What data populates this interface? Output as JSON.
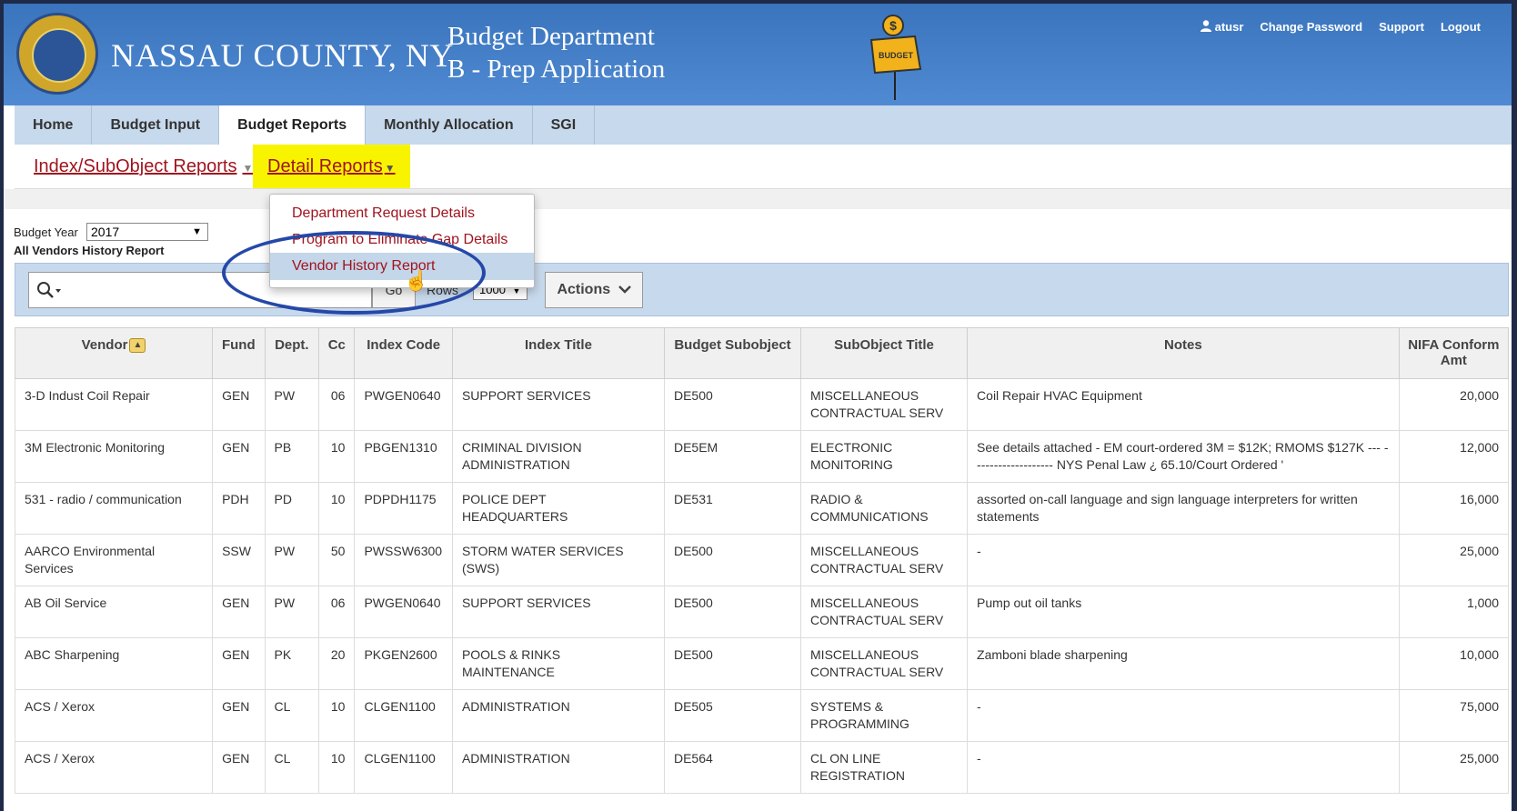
{
  "header": {
    "county": "NASSAU COUNTY, NY",
    "dept_line1": "Budget Department",
    "dept_line2": "B - Prep Application",
    "sign_text": "BUDGET",
    "user": "atusr",
    "change_password": "Change Password",
    "support": "Support",
    "logout": "Logout"
  },
  "tabs": [
    {
      "label": "Home"
    },
    {
      "label": "Budget Input"
    },
    {
      "label": "Budget Reports",
      "active": true
    },
    {
      "label": "Monthly Allocation"
    },
    {
      "label": "SGI"
    }
  ],
  "subnav": {
    "index_reports": "Index/SubObject Reports",
    "detail_reports": "Detail Reports"
  },
  "dropdown": [
    "Department Request Details",
    "Program to Eliminate Gap Details",
    "Vendor History Report"
  ],
  "filters": {
    "budget_year_label": "Budget Year",
    "budget_year_value": "2017",
    "report_title": "All Vendors History Report"
  },
  "toolbar": {
    "go_label": "Go",
    "rows_label": "Rows",
    "rows_value": "1000",
    "actions_label": "Actions"
  },
  "table": {
    "columns": [
      "Vendor",
      "Fund",
      "Dept.",
      "Cc",
      "Index Code",
      "Index Title",
      "Budget Subobject",
      "SubObject Title",
      "Notes",
      "NIFA Conform Amt"
    ],
    "rows": [
      [
        "3-D Indust Coil Repair",
        "GEN",
        "PW",
        "06",
        "PWGEN0640",
        "SUPPORT SERVICES",
        "DE500",
        "MISCELLANEOUS CONTRACTUAL SERV",
        "Coil Repair HVAC Equipment",
        "20,000"
      ],
      [
        "3M Electronic Monitoring",
        "GEN",
        "PB",
        "10",
        "PBGEN1310",
        "CRIMINAL DIVISION ADMINISTRATION",
        "DE5EM",
        "ELECTRONIC MONITORING",
        "See details attached - EM court-ordered 3M = $12K; RMOMS $127K --- ------------------- NYS Penal Law ¿ 65.10/Court Ordered '",
        "12,000"
      ],
      [
        "531 - radio / communication",
        "PDH",
        "PD",
        "10",
        "PDPDH1175",
        "POLICE DEPT HEADQUARTERS",
        "DE531",
        "RADIO & COMMUNICATIONS",
        "assorted on-call language and sign language interpreters for written statements",
        "16,000"
      ],
      [
        "AARCO Environmental Services",
        "SSW",
        "PW",
        "50",
        "PWSSW6300",
        "STORM WATER SERVICES (SWS)",
        "DE500",
        "MISCELLANEOUS CONTRACTUAL SERV",
        "-",
        "25,000"
      ],
      [
        "AB Oil Service",
        "GEN",
        "PW",
        "06",
        "PWGEN0640",
        "SUPPORT SERVICES",
        "DE500",
        "MISCELLANEOUS CONTRACTUAL SERV",
        "Pump out oil tanks",
        "1,000"
      ],
      [
        "ABC Sharpening",
        "GEN",
        "PK",
        "20",
        "PKGEN2600",
        "POOLS & RINKS MAINTENANCE",
        "DE500",
        "MISCELLANEOUS CONTRACTUAL SERV",
        "Zamboni blade sharpening",
        "10,000"
      ],
      [
        "ACS / Xerox",
        "GEN",
        "CL",
        "10",
        "CLGEN1100",
        "ADMINISTRATION",
        "DE505",
        "SYSTEMS & PROGRAMMING",
        "-",
        "75,000"
      ],
      [
        "ACS / Xerox",
        "GEN",
        "CL",
        "10",
        "CLGEN1100",
        "ADMINISTRATION",
        "DE564",
        "CL ON LINE REGISTRATION",
        "-",
        "25,000"
      ]
    ]
  },
  "colors": {
    "header_blue": "#3a74bd",
    "tab_bar": "#c7d9ec",
    "link_red": "#a0141e",
    "highlight_yellow": "#f8f400",
    "annotation_oval": "#2548a8"
  }
}
